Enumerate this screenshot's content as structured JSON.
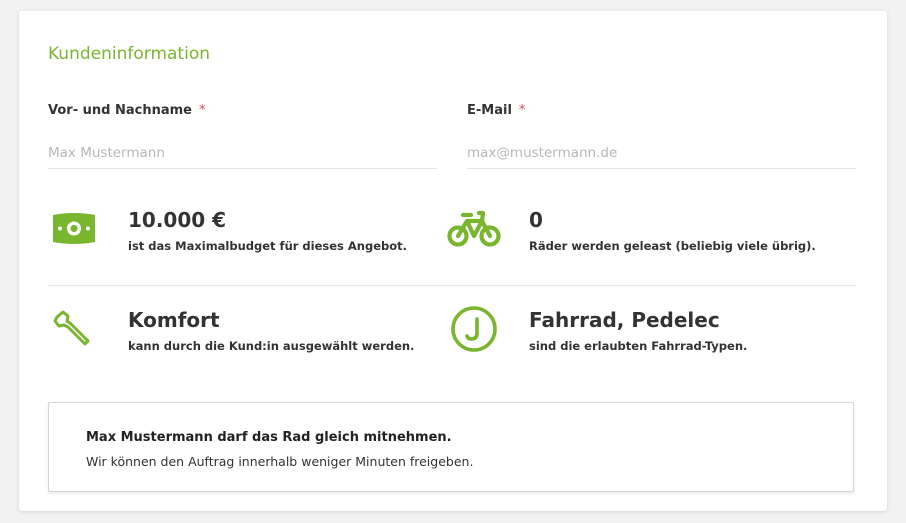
{
  "customer_info": {
    "title": "Kundeninformation",
    "name_field": {
      "label": "Vor- und Nachname",
      "required_mark": "*",
      "placeholder": "Max Mustermann",
      "value": ""
    },
    "email_field": {
      "label": "E-Mail",
      "required_mark": "*",
      "placeholder": "max@mustermann.de",
      "value": ""
    }
  },
  "info_items": [
    {
      "icon": "money-icon",
      "value": "10.000 €",
      "description": "ist das Maximalbudget für dieses Angebot."
    },
    {
      "icon": "bicycle-icon",
      "value": "0",
      "description": "Räder werden geleast (beliebig viele übrig)."
    },
    {
      "icon": "wrench-icon",
      "value": "Komfort",
      "description": "kann durch die Kund:in ausgewählt werden."
    },
    {
      "icon": "circle-j-icon",
      "value": "Fahrrad, Pedelec",
      "description": "sind die erlaubten Fahrrad-Typen."
    }
  ],
  "notice": {
    "title": "Max Mustermann darf das Rad gleich mitnehmen.",
    "text": "Wir können den Auftrag innerhalb weniger Minuten freigeben."
  },
  "colors": {
    "accent": "#7ab530",
    "required": "#d9475f",
    "text": "#333333"
  }
}
